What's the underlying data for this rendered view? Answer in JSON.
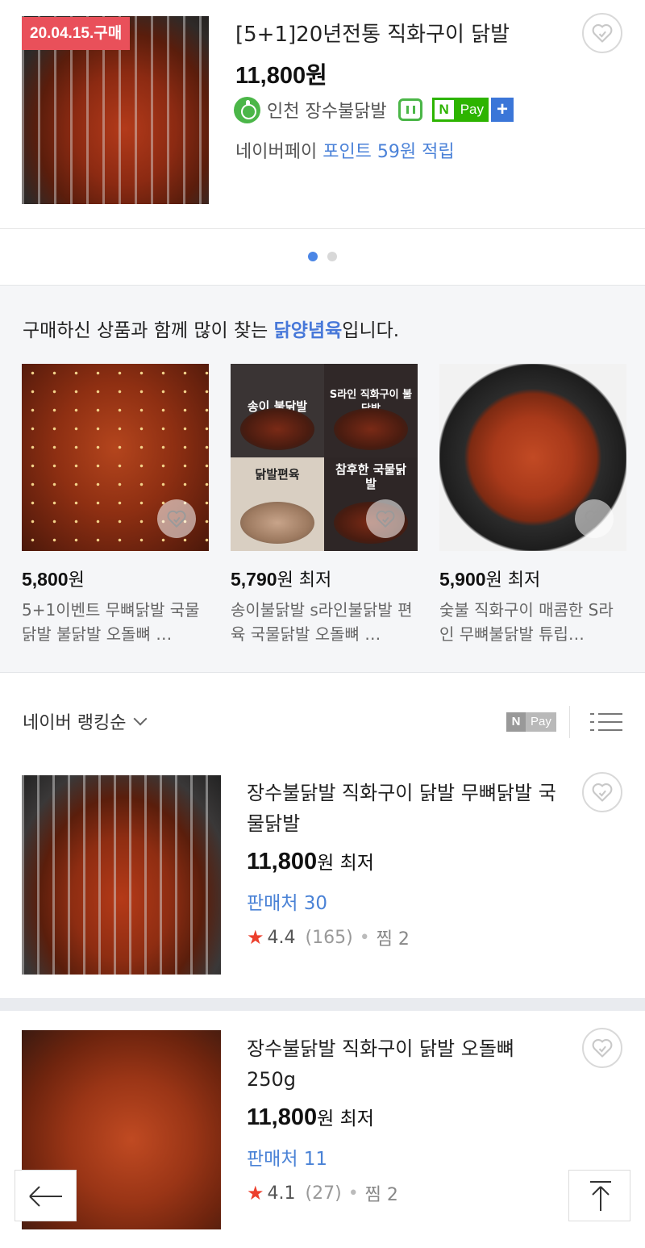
{
  "purchased": {
    "badge": "20.04.15.구매",
    "title": "[5+1]20년전통 직화구이 닭발",
    "price": "11,800원",
    "store": "인천 장수불닭발",
    "npay_n": "N",
    "npay_pay": "Pay",
    "npay_plus": "+",
    "point_prefix": "네이버페이 ",
    "point_text": "포인트 59원 적립"
  },
  "carousel": {
    "pages": 2,
    "active": 0
  },
  "recommend": {
    "title_prefix": "구매하신 상품과 함께 많이 찾는 ",
    "title_keyword": "닭양념육",
    "title_suffix": "입니다.",
    "items": [
      {
        "price": "5,800",
        "unit": "원",
        "suffix": "",
        "name": "5+1이벤트 무뼈닭발 국물닭발 불닭발 오돌뼈 …"
      },
      {
        "price": "5,790",
        "unit": "원",
        "suffix": " 최저",
        "name": "송이불닭발 s라인불닭발 편육 국물닭발 오돌뼈 …",
        "collage": [
          "송이 불닭발",
          "S라인 직화구이 불닭발",
          "닭발편육",
          "참후한 국물닭발"
        ]
      },
      {
        "price": "5,900",
        "unit": "원",
        "suffix": " 최저",
        "name": "숯불 직화구이 매콤한 S라인 무뼈불닭발 튜립…"
      }
    ]
  },
  "sort": {
    "label": "네이버 랭킹순",
    "npay_n": "N",
    "npay_pay": "Pay"
  },
  "products": [
    {
      "title": "장수불닭발 직화구이 닭발 무뼈닭발 국물닭발",
      "price": "11,800",
      "unit": "원",
      "suffix": " 최저",
      "seller": "판매처 30",
      "rating": "4.4",
      "reviews": "(165)",
      "zzim": "찜 2"
    },
    {
      "title": "장수불닭발 직화구이 닭발 오돌뼈 250g",
      "price": "11,800",
      "unit": "원",
      "suffix": " 최저",
      "seller": "판매처 11",
      "rating": "4.1",
      "reviews": "(27)",
      "zzim": "찜 2"
    }
  ],
  "colors": {
    "accent": "#4778d9",
    "badge": "#e9505a",
    "npay": "#2db400",
    "star": "#ec3f2c"
  },
  "icons": [
    "heart-icon",
    "apple-store-icon",
    "talk-icon",
    "npay-icon",
    "chevron-down-icon",
    "list-view-icon",
    "arrow-left-icon",
    "arrow-up-icon"
  ]
}
